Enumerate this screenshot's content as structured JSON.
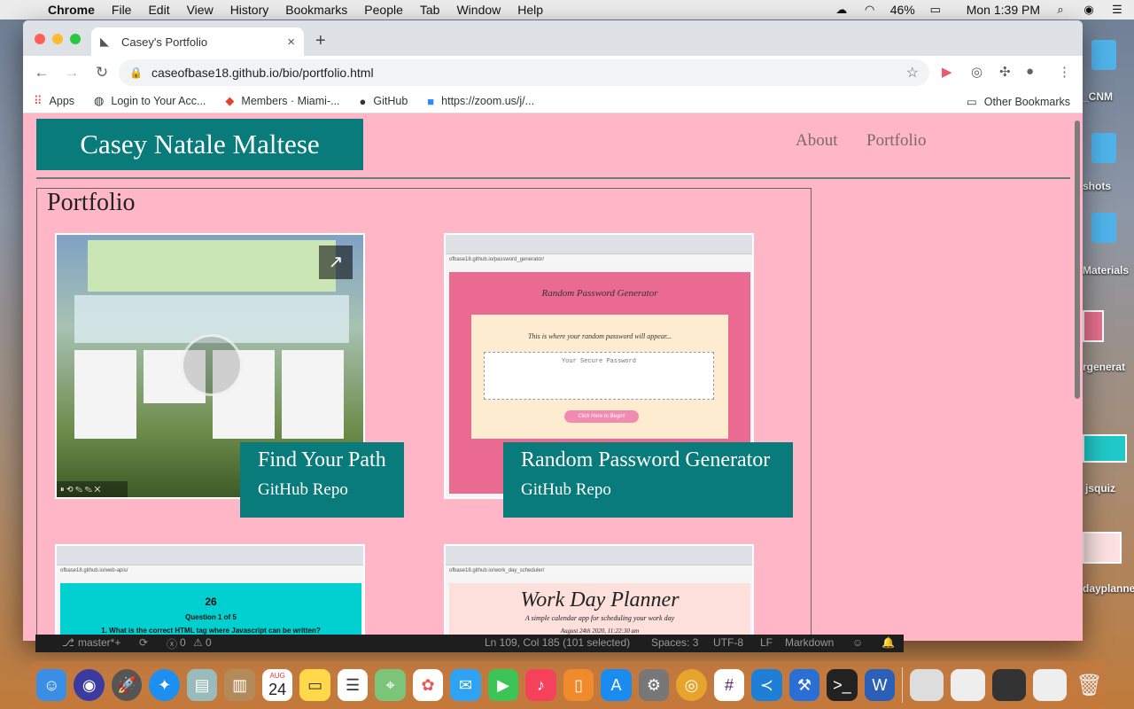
{
  "menubar": {
    "app": "Chrome",
    "items": [
      "File",
      "Edit",
      "View",
      "History",
      "Bookmarks",
      "People",
      "Tab",
      "Window",
      "Help"
    ],
    "battery": "46%",
    "clock": "Mon 1:39 PM"
  },
  "browser": {
    "tab_title": "Casey's Portfolio",
    "url": "caseofbase18.github.io/bio/portfolio.html",
    "bookmarks": [
      {
        "label": "Apps",
        "icon": "apps-grid-icon"
      },
      {
        "label": "Login to Your Acc...",
        "icon": "globe-icon"
      },
      {
        "label": "Members · Miami-...",
        "icon": "gitlab-icon"
      },
      {
        "label": "GitHub",
        "icon": "github-icon"
      },
      {
        "label": "https://zoom.us/j/...",
        "icon": "zoom-icon"
      }
    ],
    "other_bookmarks": "Other Bookmarks"
  },
  "page": {
    "brand": "Casey Natale Maltese",
    "nav": [
      "About",
      "Portfolio"
    ],
    "section_title": "Portfolio",
    "projects": [
      {
        "title": "Find Your Path",
        "link": "GitHub Repo"
      },
      {
        "title": "Random Password Generator",
        "link": "GitHub Repo"
      }
    ],
    "thumb_password": {
      "heading": "Random Password Generator",
      "prompt": "This is where your random password will appear...",
      "placeholder": "Your Secure Password",
      "button": "Click Here to Begin!"
    },
    "thumb_quiz": {
      "url": "ofbase18.github.io/web-apis/",
      "score": "26",
      "question_num": "Question 1 of 5",
      "question": "1. What is the correct HTML tag where Javascript can be written?"
    },
    "thumb_planner": {
      "url": "ofbase18.github.io/work_day_scheduler/",
      "title": "Work Day Planner",
      "subtitle": "A simple calendar app for scheduling your work day",
      "date": "August 24th 2020, 11:22:30 am"
    },
    "thumb_pass_url": "ofbase18.github.io/password_generator/"
  },
  "desktop": {
    "labels": [
      "_CNM",
      "shots",
      "Materials",
      "rgenerat",
      "jsquiz",
      "dayplanne"
    ]
  },
  "statusbar": {
    "branch": "master*+",
    "position": "Ln 109, Col 185 (101 selected)",
    "spaces": "Spaces: 3",
    "encoding": "UTF-8",
    "eol": "LF",
    "language": "Markdown",
    "errors": "0",
    "warnings": "0"
  },
  "dock": {
    "calendar_day": "24",
    "calendar_month": "AUG"
  },
  "colors": {
    "page_bg": "#ffb6c6",
    "brand_teal": "#0a7b7b"
  }
}
